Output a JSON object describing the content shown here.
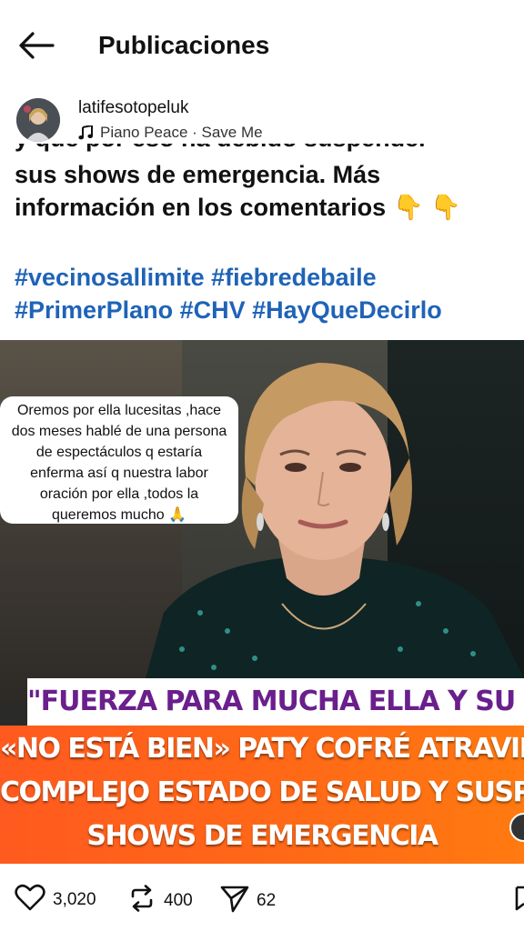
{
  "header": {
    "title": "Publicaciones",
    "back_icon": "back-arrow-icon"
  },
  "author": {
    "username": "latifesotopeluk",
    "music_icon": "music-note-icon",
    "music_text": "Piano Peace · Save Me"
  },
  "caption": {
    "line_clipped": "y que por eso ha debido suspender",
    "line1": "sus shows de emergencia. Más",
    "line2": "información en los comentarios",
    "emoji": "👇 👇"
  },
  "hashtags": {
    "row1": [
      "#vecinosallimite",
      "#fiebredebaile"
    ],
    "row2": [
      "#PrimerPlano",
      "#CHV",
      "#HayQueDecirlo"
    ]
  },
  "image": {
    "bubble_lines": [
      "Oremos por ella lucesitas ,hace",
      "dos meses hablé de una persona",
      "de espectáculos q estaría",
      "enferma así q nuestra labor",
      "oración por ella ,todos la",
      "queremos mucho 🙏"
    ],
    "banner_purple": "\"FUERZA PARA MUCHA  ELLA Y SU FAMILIA \"",
    "banner_orange": [
      "«NO ESTÁ BIEN» PATY COFRÉ ATRAVIESA",
      "COMPLEJO ESTADO DE SALUD Y SUSPENDE SUS",
      "SHOWS DE EMERGENCIA"
    ],
    "colors": {
      "purple_text": "#6a1f8c",
      "orange_bg": "#ff6a16"
    }
  },
  "actions": {
    "likes": "3,020",
    "reposts": "400",
    "shares": "62",
    "icons": [
      "heart-icon",
      "repost-icon",
      "send-icon",
      "bookmark-icon"
    ]
  }
}
